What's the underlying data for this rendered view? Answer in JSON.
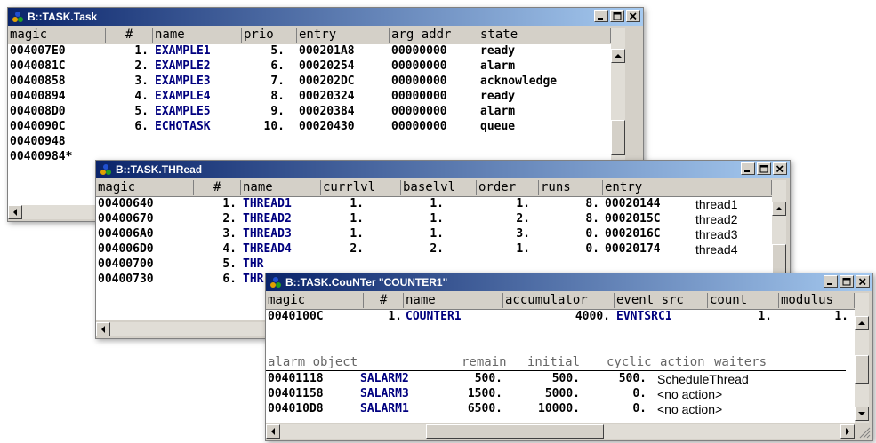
{
  "task_window": {
    "title": "B::TASK.Task",
    "columns": [
      "magic",
      "#",
      "name",
      "prio",
      "entry",
      "arg addr",
      "state"
    ],
    "rows": [
      {
        "magic": "004007E0",
        "num": "1.",
        "name": "EXAMPLE1",
        "prio": "5.",
        "entry": "000201A8",
        "arg": "00000000",
        "state": "ready"
      },
      {
        "magic": "0040081C",
        "num": "2.",
        "name": "EXAMPLE2",
        "prio": "6.",
        "entry": "00020254",
        "arg": "00000000",
        "state": "alarm"
      },
      {
        "magic": "00400858",
        "num": "3.",
        "name": "EXAMPLE3",
        "prio": "7.",
        "entry": "000202DC",
        "arg": "00000000",
        "state": "acknowledge"
      },
      {
        "magic": "00400894",
        "num": "4.",
        "name": "EXAMPLE4",
        "prio": "8.",
        "entry": "00020324",
        "arg": "00000000",
        "state": "ready"
      },
      {
        "magic": "004008D0",
        "num": "5.",
        "name": "EXAMPLE5",
        "prio": "9.",
        "entry": "00020384",
        "arg": "00000000",
        "state": "alarm"
      },
      {
        "magic": "0040090C",
        "num": "6.",
        "name": "ECHOTASK",
        "prio": "10.",
        "entry": "00020430",
        "arg": "00000000",
        "state": "queue"
      },
      {
        "magic": "00400948",
        "num": "",
        "name": "",
        "prio": "",
        "entry": "",
        "arg": "",
        "state": ""
      },
      {
        "magic": "00400984*",
        "num": "",
        "name": "",
        "prio": "",
        "entry": "",
        "arg": "",
        "state": ""
      }
    ]
  },
  "thread_window": {
    "title": "B::TASK.THRead",
    "columns": [
      "magic",
      "#",
      "name",
      "currlvl",
      "baselvl",
      "order",
      "runs",
      "entry"
    ],
    "rows": [
      {
        "magic": "00400640",
        "num": "1.",
        "name": "THREAD1",
        "currlvl": "1.",
        "baselvl": "1.",
        "order": "1.",
        "runs": "8.",
        "entry": "00020144",
        "sym": "thread1"
      },
      {
        "magic": "00400670",
        "num": "2.",
        "name": "THREAD2",
        "currlvl": "1.",
        "baselvl": "1.",
        "order": "2.",
        "runs": "8.",
        "entry": "0002015C",
        "sym": "thread2"
      },
      {
        "magic": "004006A0",
        "num": "3.",
        "name": "THREAD3",
        "currlvl": "1.",
        "baselvl": "1.",
        "order": "3.",
        "runs": "0.",
        "entry": "0002016C",
        "sym": "thread3"
      },
      {
        "magic": "004006D0",
        "num": "4.",
        "name": "THREAD4",
        "currlvl": "2.",
        "baselvl": "2.",
        "order": "1.",
        "runs": "0.",
        "entry": "00020174",
        "sym": "thread4"
      },
      {
        "magic": "00400700",
        "num": "5.",
        "name": "THR",
        "currlvl": "",
        "baselvl": "",
        "order": "",
        "runs": "",
        "entry": "",
        "sym": ""
      },
      {
        "magic": "00400730",
        "num": "6.",
        "name": "THR",
        "currlvl": "",
        "baselvl": "",
        "order": "",
        "runs": "",
        "entry": "",
        "sym": ""
      }
    ]
  },
  "counter_window": {
    "title": "B::TASK.CouNTer \"COUNTER1\"",
    "columns": [
      "magic",
      "#",
      "name",
      "accumulator",
      "event src",
      "count",
      "modulus"
    ],
    "row": {
      "magic": "0040100C",
      "num": "1.",
      "name": "COUNTER1",
      "accumulator": "4000.",
      "event_src": "EVNTSRC1",
      "count": "1.",
      "modulus": "1."
    },
    "alarm_header": {
      "object": "alarm object",
      "remain": "remain",
      "initial": "initial",
      "cyclic": "cyclic",
      "action": "action",
      "waiters": "waiters"
    },
    "alarms": [
      {
        "addr": "00401118",
        "name": "SALARM2",
        "remain": "500.",
        "initial": "500.",
        "cyclic": "500.",
        "action": "ScheduleThread"
      },
      {
        "addr": "00401158",
        "name": "SALARM3",
        "remain": "1500.",
        "initial": "5000.",
        "cyclic": "0.",
        "action": "<no action>"
      },
      {
        "addr": "004010D8",
        "name": "SALARM1",
        "remain": "6500.",
        "initial": "10000.",
        "cyclic": "0.",
        "action": "<no action>"
      }
    ]
  },
  "colors": {
    "title_start": "#0a246a",
    "title_end": "#a6caf0",
    "name_blue": "#00007f",
    "face": "#d4d0c8"
  },
  "icons": [
    "app-icon",
    "minimize-icon",
    "maximize-icon",
    "close-icon",
    "scroll-up-arrow-icon",
    "scroll-down-arrow-icon",
    "scroll-left-arrow-icon",
    "scroll-right-arrow-icon",
    "size-grip-icon"
  ]
}
